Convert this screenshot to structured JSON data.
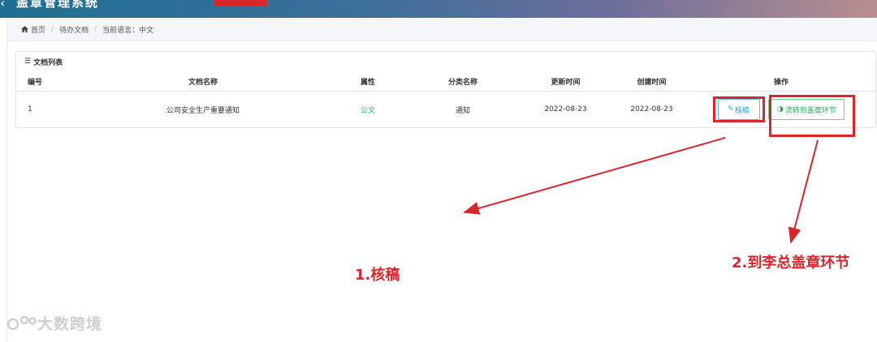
{
  "app": {
    "title": "盖章管理系统"
  },
  "breadcrumb": {
    "home": "首页",
    "page": "待办文档",
    "language": "当前语言：中文"
  },
  "panel": {
    "title": "文档列表",
    "columns": [
      "编号",
      "文档名称",
      "属性",
      "分类名称",
      "更新时间",
      "创建时间",
      "操作"
    ],
    "rows": [
      {
        "id": "1",
        "name": "公司安全生产重要通知",
        "attribute": "公文",
        "category": "通知",
        "updated": "2022-08-23",
        "created": "2022-08-23",
        "review_label": "核稿",
        "flow_label": "流转到盖章环节"
      }
    ]
  },
  "annotations": {
    "step1": "1.核稿",
    "step2": "2.到李总盖章环节"
  },
  "watermark": {
    "text": "大数跨境"
  },
  "colors": {
    "accent_red": "#d9262c",
    "link_green": "#26b37a",
    "review_blue": "#2a9fd6",
    "flow_green": "#26a65b"
  }
}
